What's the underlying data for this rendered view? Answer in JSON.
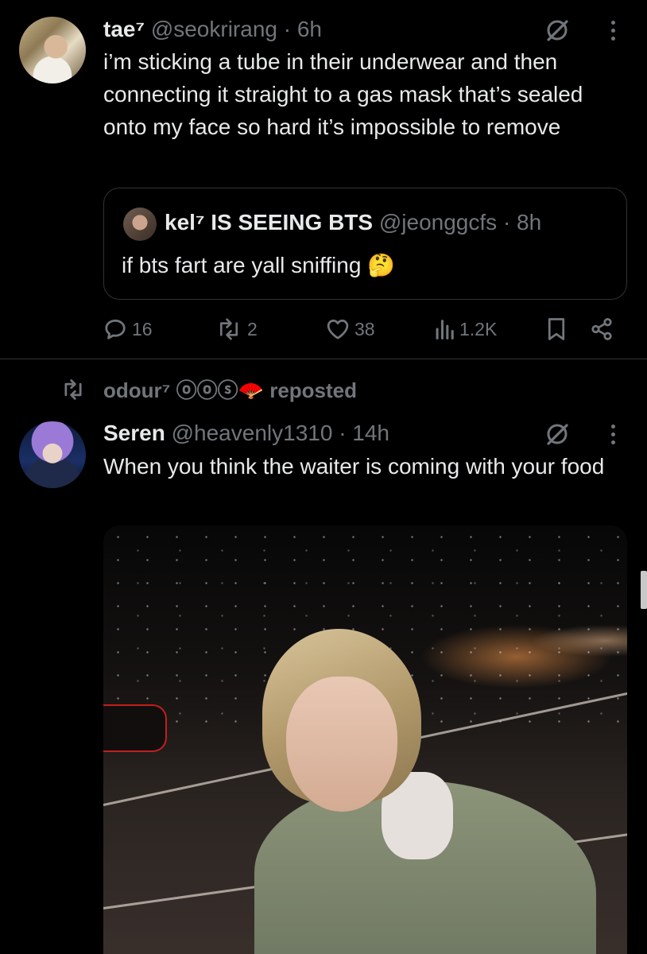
{
  "tweet1": {
    "display_name": "tae⁷",
    "handle": "@seokrirang",
    "time": "· 6h",
    "text": "i’m sticking a tube in their underwear and then connecting it straight to a gas mask that’s sealed onto my face so hard it’s impossible to remove",
    "quote": {
      "display_name": "kel⁷ IS SEEING BTS",
      "handle": "@jeonggcfs",
      "time": "· 8h",
      "text": "if bts fart are yall sniffing",
      "emoji": "🤔"
    },
    "actions": {
      "replies": "16",
      "reposts": "2",
      "likes": "38",
      "views": "1.2K"
    }
  },
  "repost_banner": {
    "reposter": "odour⁷ ⓞⓞⓢ🪭",
    "label": "reposted"
  },
  "tweet2": {
    "display_name": "Seren",
    "handle": "@heavenly1310",
    "time": "· 14h",
    "text": "When you think the waiter is coming with your food"
  },
  "icons": [
    "grok-icon",
    "more-icon",
    "reply-icon",
    "repost-icon",
    "like-icon",
    "views-icon",
    "bookmark-icon",
    "share-icon"
  ],
  "colors": {
    "background": "#000000",
    "text": "#e7e9ea",
    "muted": "#71767b",
    "border": "#2f3336"
  }
}
